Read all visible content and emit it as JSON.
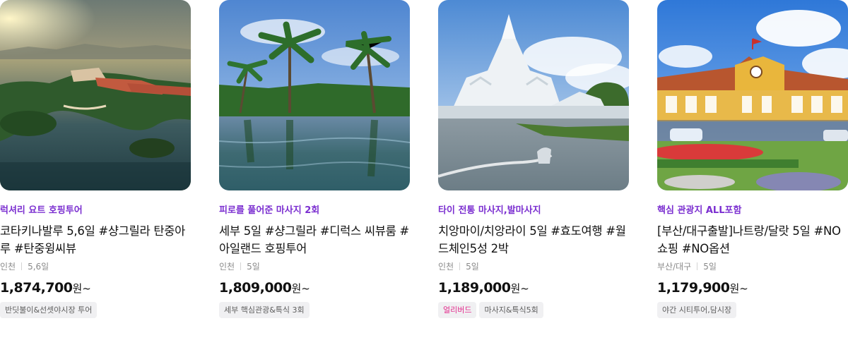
{
  "cards": [
    {
      "tag": "럭셔리 요트 호핑투어",
      "title": "코타키나발루 5,6일 #샹그릴라 탄중아루 #탄중윙씨뷰",
      "departure": "인천",
      "duration": "5,6일",
      "price": "1,874,700",
      "price_suffix": "원~",
      "badges": [
        {
          "text": "반딧불이&선셋야시장 투어",
          "highlight": false
        }
      ]
    },
    {
      "tag": "피로를 풀어준 마사지 2회",
      "title": "세부 5일 #샹그릴라 #디럭스 씨뷰룸 #아일랜드 호핑투어",
      "departure": "인천",
      "duration": "5일",
      "price": "1,809,000",
      "price_suffix": "원~",
      "badges": [
        {
          "text": "세부 핵심관광&특식 3회",
          "highlight": false
        }
      ]
    },
    {
      "tag": "타이 전통 마사지,발마사지",
      "title": "치앙마이/치앙라이 5일 #효도여행 #월드체인5성 2박",
      "departure": "인천",
      "duration": "5일",
      "price": "1,189,000",
      "price_suffix": "원~",
      "badges": [
        {
          "text": "얼리버드",
          "highlight": true
        },
        {
          "text": "마사지&특식5회",
          "highlight": false
        }
      ]
    },
    {
      "tag": "핵심 관광지 ALL포함",
      "title": "[부산/대구출발]나트랑/달랏 5일 #NO쇼핑 #NO옵션",
      "departure": "부산/대구",
      "duration": "5일",
      "price": "1,179,900",
      "price_suffix": "원~",
      "badges": [
        {
          "text": "야간 시티투어,담시장",
          "highlight": false
        }
      ]
    }
  ],
  "colors": {
    "tag": "#7b2fd0",
    "highlight_badge": "#e32b8c",
    "badge_bg": "#f0f0f2"
  }
}
